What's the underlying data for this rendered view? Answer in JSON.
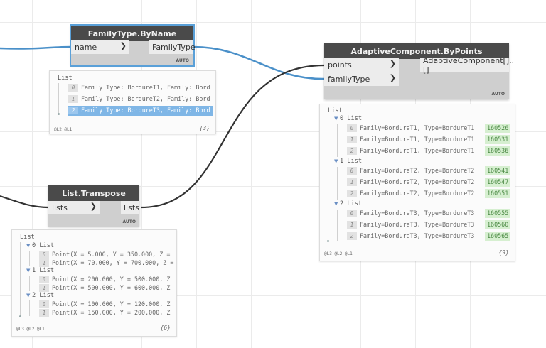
{
  "nodes": {
    "familytype": {
      "title": "FamilyType.ByName",
      "input": "name",
      "output": "FamilyType",
      "auto": "AUTO"
    },
    "adaptive": {
      "title": "AdaptiveComponent.ByPoints",
      "input1": "points",
      "input2": "familyType",
      "output": "AdaptiveComponent[]..[]",
      "auto": "AUTO"
    },
    "transpose": {
      "title": "List.Transpose",
      "input": "lists",
      "output": "lists",
      "auto": "AUTO"
    }
  },
  "previews": {
    "familytype": {
      "root": "List",
      "items": [
        {
          "index": "0",
          "text": "Family Type: BordureT1, Family: Bord"
        },
        {
          "index": "1",
          "text": "Family Type: BordureT2, Family: Bord"
        },
        {
          "index": "2",
          "text": "Family Type: BordureT3, Family: Bord"
        }
      ],
      "levels": "@L2 @L1",
      "count": "{3}"
    },
    "adaptive": {
      "root": "List",
      "groups": [
        {
          "label": "0 List",
          "rows": [
            {
              "index": "0",
              "text": "Family=BordureT1, Type=BordureT1",
              "id": "160526"
            },
            {
              "index": "1",
              "text": "Family=BordureT1, Type=BordureT1",
              "id": "160531"
            },
            {
              "index": "2",
              "text": "Family=BordureT1, Type=BordureT1",
              "id": "160536"
            }
          ]
        },
        {
          "label": "1 List",
          "rows": [
            {
              "index": "0",
              "text": "Family=BordureT2, Type=BordureT2",
              "id": "160541"
            },
            {
              "index": "1",
              "text": "Family=BordureT2, Type=BordureT2",
              "id": "160547"
            },
            {
              "index": "2",
              "text": "Family=BordureT2, Type=BordureT2",
              "id": "160551"
            }
          ]
        },
        {
          "label": "2 List",
          "rows": [
            {
              "index": "0",
              "text": "Family=BordureT3, Type=BordureT3",
              "id": "160555"
            },
            {
              "index": "1",
              "text": "Family=BordureT3, Type=BordureT3",
              "id": "160560"
            },
            {
              "index": "2",
              "text": "Family=BordureT3, Type=BordureT3",
              "id": "160565"
            }
          ]
        }
      ],
      "levels": "@L3 @L2 @L1",
      "count": "{9}"
    },
    "transpose": {
      "root": "List",
      "groups": [
        {
          "label": "0 List",
          "rows": [
            {
              "index": "0",
              "text": "Point(X = 5.000, Y = 350.000, Z ="
            },
            {
              "index": "1",
              "text": "Point(X = 70.000, Y = 700.000, Z ="
            }
          ]
        },
        {
          "label": "1 List",
          "rows": [
            {
              "index": "0",
              "text": "Point(X = 200.000, Y = 500.000, Z"
            },
            {
              "index": "1",
              "text": "Point(X = 500.000, Y = 600.000, Z"
            }
          ]
        },
        {
          "label": "2 List",
          "rows": [
            {
              "index": "0",
              "text": "Point(X = 100.000, Y = 120.000, Z"
            },
            {
              "index": "1",
              "text": "Point(X = 150.000, Y = 200.000, Z"
            }
          ]
        }
      ],
      "levels": "@L3 @L2 @L1",
      "count": "{6}"
    }
  },
  "colors": {
    "wire_selected": "#4a90c9",
    "wire_default": "#333333",
    "header": "#4a4a4a",
    "highlight": "#7fb6e6",
    "id_badge": "#d6efd0"
  }
}
